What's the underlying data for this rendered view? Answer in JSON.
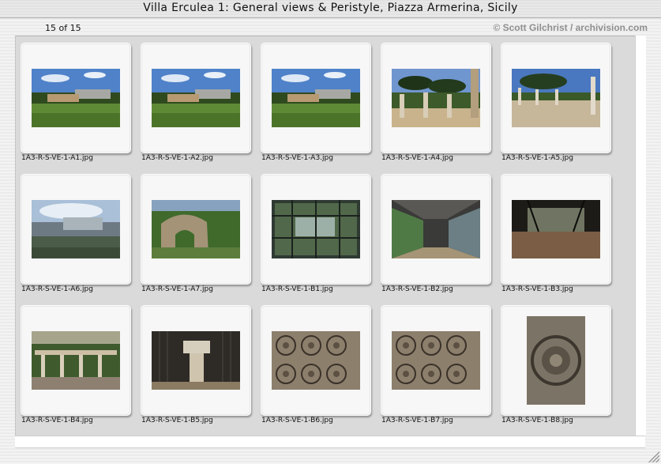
{
  "window": {
    "title": "Villa Erculea 1: General views & Peristyle, Piazza Armerina, Sicily",
    "count_label": "15 of 15",
    "copyright": "© Scott Gilchrist / archivision.com"
  },
  "thumbnails": [
    {
      "filename": "1A3-R-S-VE-1-A1.jpg",
      "scene": "ruins-landscape"
    },
    {
      "filename": "1A3-R-S-VE-1-A2.jpg",
      "scene": "ruins-landscape"
    },
    {
      "filename": "1A3-R-S-VE-1-A3.jpg",
      "scene": "ruins-landscape"
    },
    {
      "filename": "1A3-R-S-VE-1-A4.jpg",
      "scene": "columns-pines"
    },
    {
      "filename": "1A3-R-S-VE-1-A5.jpg",
      "scene": "peristyle-courtyard"
    },
    {
      "filename": "1A3-R-S-VE-1-A6.jpg",
      "scene": "cloudy-ruins"
    },
    {
      "filename": "1A3-R-S-VE-1-A7.jpg",
      "scene": "stone-arch"
    },
    {
      "filename": "1A3-R-S-VE-1-B1.jpg",
      "scene": "glass-walkway"
    },
    {
      "filename": "1A3-R-S-VE-1-B2.jpg",
      "scene": "covered-corridor"
    },
    {
      "filename": "1A3-R-S-VE-1-B3.jpg",
      "scene": "dark-interior"
    },
    {
      "filename": "1A3-R-S-VE-1-B4.jpg",
      "scene": "portico-ruins"
    },
    {
      "filename": "1A3-R-S-VE-1-B5.jpg",
      "scene": "corinthian-capital"
    },
    {
      "filename": "1A3-R-S-VE-1-B6.jpg",
      "scene": "mosaic-floor"
    },
    {
      "filename": "1A3-R-S-VE-1-B7.jpg",
      "scene": "mosaic-floor"
    },
    {
      "filename": "1A3-R-S-VE-1-B8.jpg",
      "scene": "mosaic-medallion"
    }
  ]
}
